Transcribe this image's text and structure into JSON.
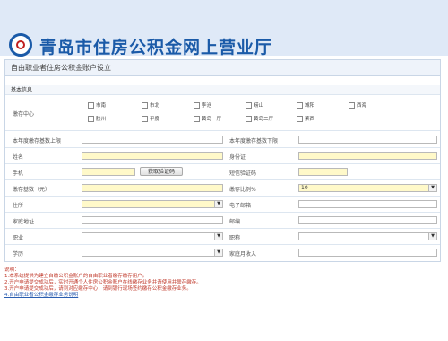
{
  "header": {
    "title": "青岛市住房公积金网上营业厅"
  },
  "panel": {
    "title": "自由职业者住房公积金账户设立",
    "section": "基本信息"
  },
  "center": {
    "label": "缴存中心",
    "options": [
      "市南",
      "市北",
      "李沧",
      "崂山",
      "城阳",
      "西海",
      "胶州",
      "平度",
      "黄岛一厅",
      "黄岛二厅",
      "莱西"
    ]
  },
  "fields": {
    "base_max_label": "本年度缴存基数上限",
    "base_min_label": "本年度缴存基数下限",
    "name_label": "姓名",
    "id_label": "身份证",
    "phone_label": "手机",
    "get_code_button": "获取验证码",
    "sms_code_label": "短信验证码",
    "deposit_base_label": "缴存基数（元）",
    "deposit_ratio_label": "缴存比例%",
    "deposit_ratio_value": "10",
    "residence_label": "住所",
    "email_label": "电子邮箱",
    "home_address_label": "家庭地址",
    "postcode_label": "邮编",
    "occupation_label": "职业",
    "title_label": "职称",
    "education_label": "学历",
    "family_income_label": "家庭月收入"
  },
  "notes": {
    "title": "说明：",
    "items": [
      "1.本系统提供为建立自缴公积金账户的自由职业者缴存缴存用户。",
      "2.开户申请提交成功后，实时开通个人住房公积金账户在线缴存业务并请使用并联存缴存。",
      "3.开户申请提交成功后，请到对应缴存中心，请到银行现场签约缴存公积金缴存业务。",
      "4.自由职业者公积金缴存业务说明"
    ]
  }
}
